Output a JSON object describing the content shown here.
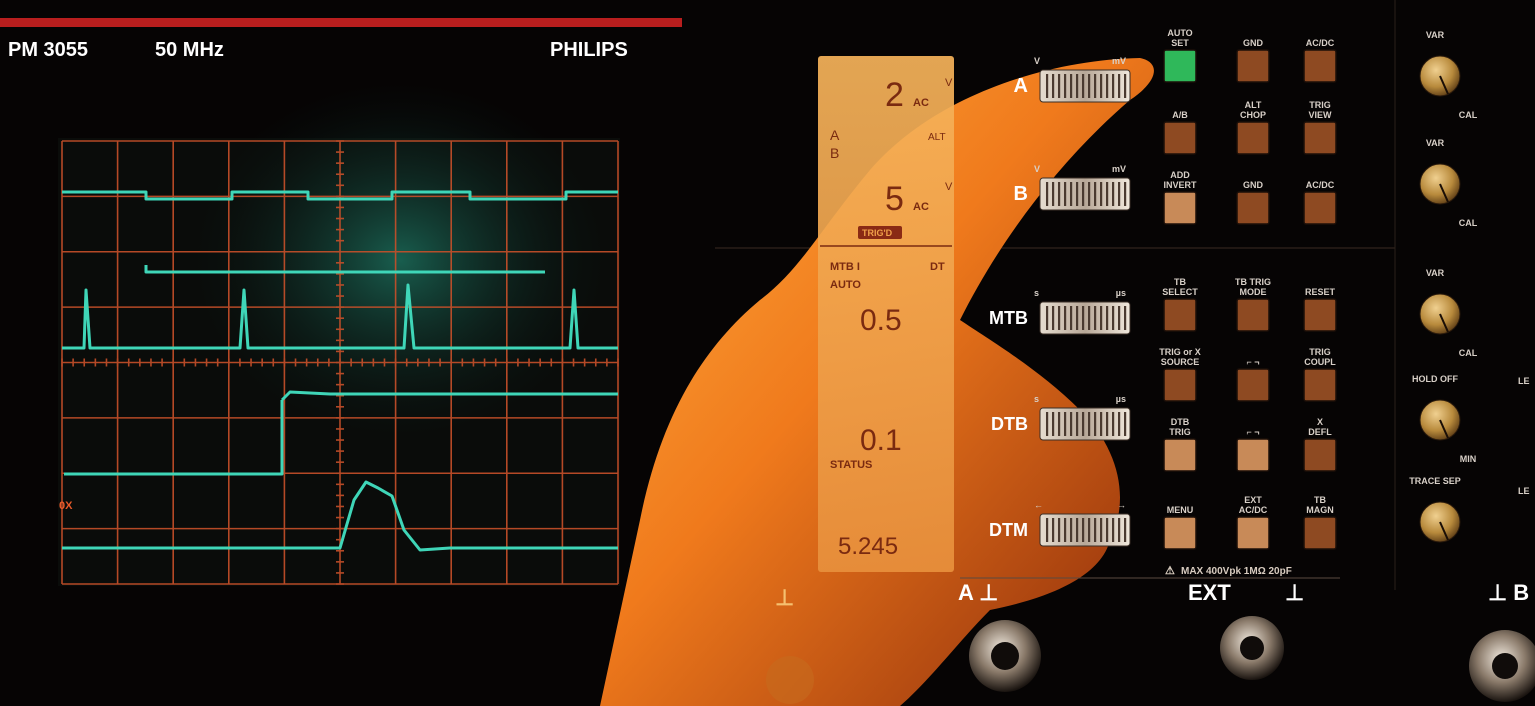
{
  "header": {
    "model": "PM 3055",
    "bandwidth": "50 MHz",
    "brand": "PHILIPS"
  },
  "screen": {
    "zero_marker": "0X"
  },
  "lcd": {
    "ch_a_value": "2",
    "ch_a_coupling": "AC",
    "ch_a_unit": "V",
    "ab_a": "A",
    "ab_b": "B",
    "alt": "ALT",
    "ch_b_value": "5",
    "ch_b_coupling": "AC",
    "ch_b_unit": "V",
    "trig_badge": "TRIG'D",
    "mtb": "MTB I",
    "dtb": "DT",
    "auto": "AUTO",
    "mtb_value": "0.5",
    "dtb_value": "0.1",
    "status": "STATUS",
    "delay_value": "5.245"
  },
  "selectors": [
    {
      "label": "A",
      "left_unit": "V",
      "right_unit": "mV"
    },
    {
      "label": "B",
      "left_unit": "V",
      "right_unit": "mV"
    },
    {
      "label": "MTB",
      "left_unit": "s",
      "right_unit": "µs"
    },
    {
      "label": "DTB",
      "left_unit": "s",
      "right_unit": "µs"
    },
    {
      "label": "DTM",
      "left_unit": "←",
      "right_unit": "→"
    }
  ],
  "buttons": {
    "auto_set": "AUTO SET",
    "gnd_a": "GND",
    "acdc_a": "AC/DC",
    "a_b": "A/B",
    "alt_chop": "ALT CHOP",
    "trig_view": "TRIG VIEW",
    "add_invert": "ADD INVERT",
    "gnd_b": "GND",
    "acdc_b": "AC/DC",
    "tb_select": "TB SELECT",
    "tb_trig_mode": "TB TRIG MODE",
    "reset": "RESET",
    "trig_source": "TRIG or X SOURCE",
    "slope_1": "⌐ ¬",
    "trig_coupl": "TRIG COUPL",
    "dtb_trig": "DTB TRIG",
    "slope_2": "⌐ ¬",
    "x_defl": "X DEFL",
    "menu": "MENU",
    "ext_acdc": "EXT AC/DC",
    "tb_magn": "TB MAGN"
  },
  "knobs": {
    "var_1": "VAR",
    "cal_1": "CAL",
    "var_2": "VAR",
    "cal_2": "CAL",
    "var_3": "VAR",
    "cal_3": "CAL",
    "hold_off": "HOLD OFF",
    "min": "MIN",
    "trace_sep": "TRACE SEP",
    "level_1": "LE",
    "level_2": "LE"
  },
  "inputs": {
    "warning": "MAX 400Vpk 1MΩ 20pF",
    "a_input": "A ⊥",
    "ext_input": "EXT",
    "ground_mid": "⊥",
    "ground_left": "⊥",
    "b_input": "⊥ B"
  },
  "colors": {
    "trace": "#3fd6b8",
    "graticule": "#c8502a",
    "lcd": "#f0a04a",
    "auto_set_led": "#2fb85a",
    "header_bar": "#b81e1e"
  }
}
